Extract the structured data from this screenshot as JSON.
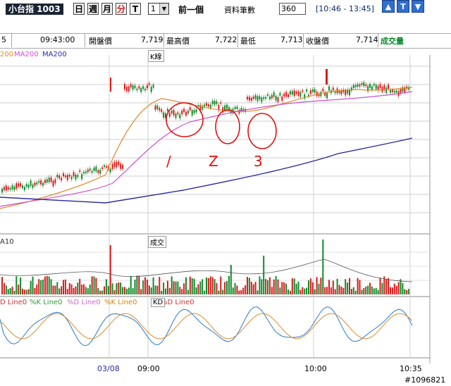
{
  "toolbar": {
    "instrument": "小台指 1003",
    "periods": [
      "日",
      "週",
      "月",
      "分",
      "T"
    ],
    "active_period": "分",
    "interval_value": "1",
    "prev_label": "前一個",
    "record_label": "資料筆數",
    "record_value": "360",
    "time_range": "[10:46 - 13:45]",
    "window_buttons": [
      "▲",
      "T",
      "▼"
    ]
  },
  "info": {
    "first_value": "5",
    "time": "09:43:00",
    "open_label": "開盤價",
    "open_value": "7,719",
    "high_label": "最高價",
    "high_value": "7,722",
    "low_label": "最低",
    "low_value": "7,713",
    "close_label": "收盤價",
    "close_value": "7,714",
    "volume_label": "成交量"
  },
  "price_panel": {
    "legend": [
      "200",
      "MA200",
      "MA200"
    ],
    "legend_colors": [
      "#e08a2a",
      "#d050d0",
      "#2a2aa0"
    ],
    "title": "K線",
    "annotations": [
      "/",
      "Z",
      "3"
    ]
  },
  "volume_panel": {
    "legend": "A10",
    "title": "成交"
  },
  "kd_panel": {
    "legend": [
      "D Line0",
      "%K Line0",
      "%D Line0",
      "%K Line0",
      "%D Line0"
    ],
    "legend_colors": [
      "#cc3333",
      "#339933",
      "#cc66cc",
      "#cc8800",
      "#cc3333"
    ],
    "title": "KD"
  },
  "xaxis": {
    "ticks": [
      "03/08",
      "09:00",
      "10:00",
      "10:35"
    ]
  },
  "watermark": "#1096821",
  "colors": {
    "up": "#d81b1b",
    "down": "#0f8a2a",
    "ma_short": "#e08a2a",
    "ma_mid": "#d050d0",
    "ma_long": "#2a2aa0"
  }
}
